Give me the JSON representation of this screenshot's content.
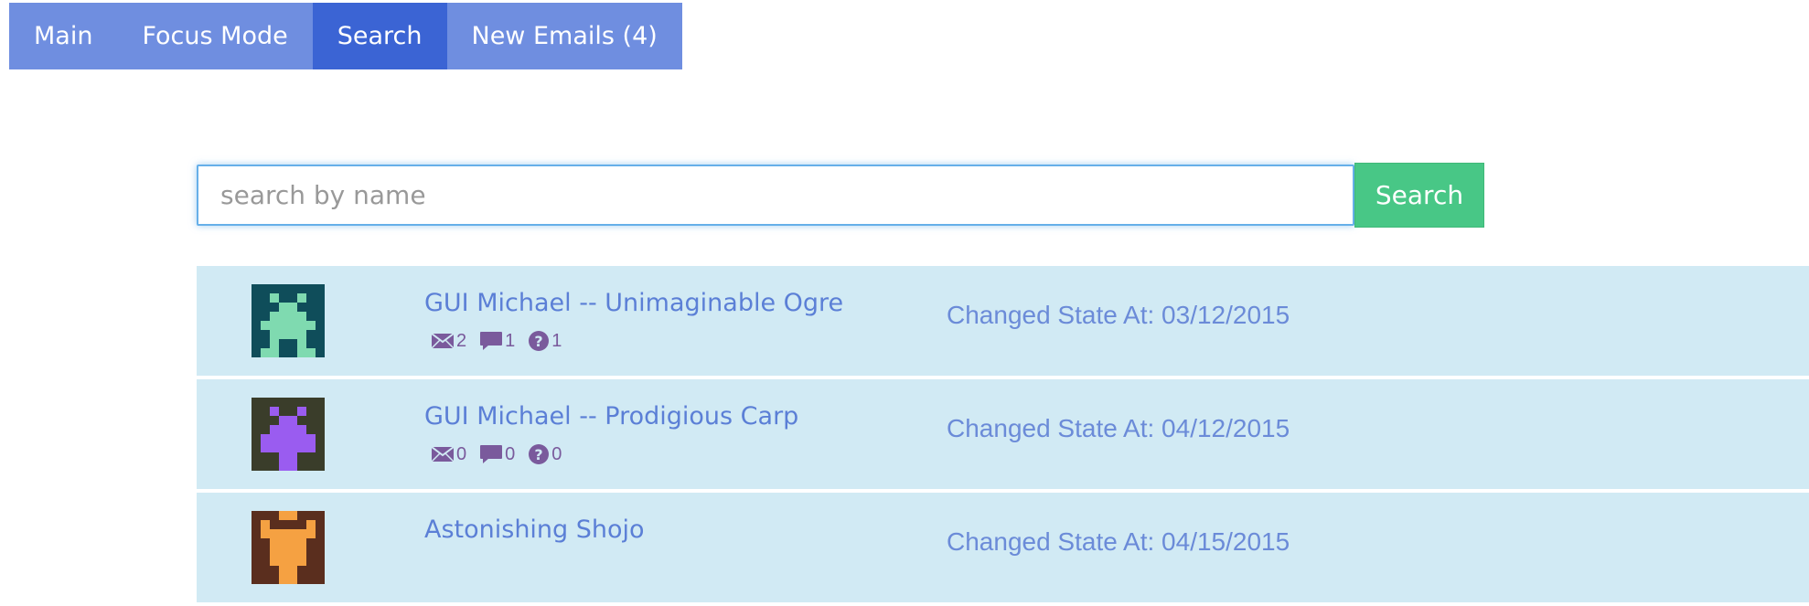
{
  "nav": {
    "tabs": [
      {
        "label": "Main",
        "active": false
      },
      {
        "label": "Focus Mode",
        "active": false
      },
      {
        "label": "Search",
        "active": true
      },
      {
        "label": "New Emails (4)",
        "active": false
      }
    ]
  },
  "search": {
    "placeholder": "search by name",
    "value": "",
    "button_label": "Search"
  },
  "results": [
    {
      "name": "GUI Michael -- Unimaginable Ogre",
      "emails": "2",
      "comments": "1",
      "questions": "1",
      "changed": "Changed State At: 03/12/2015",
      "avatar_icon": "alien-avatar-teal"
    },
    {
      "name": "GUI Michael -- Prodigious Carp",
      "emails": "0",
      "comments": "0",
      "questions": "0",
      "changed": "Changed State At: 04/12/2015",
      "avatar_icon": "alien-avatar-purple"
    },
    {
      "name": "Astonishing Shojo",
      "emails": "",
      "comments": "",
      "questions": "",
      "changed": "Changed State At: 04/15/2015",
      "avatar_icon": "alien-avatar-orange"
    }
  ],
  "colors": {
    "nav_bg": "#6f8ee0",
    "nav_active": "#3b64d4",
    "search_button": "#48c786",
    "row_bg": "#d1eaf4",
    "link": "#5b7fd6",
    "count_icon": "#7a5a9c"
  }
}
